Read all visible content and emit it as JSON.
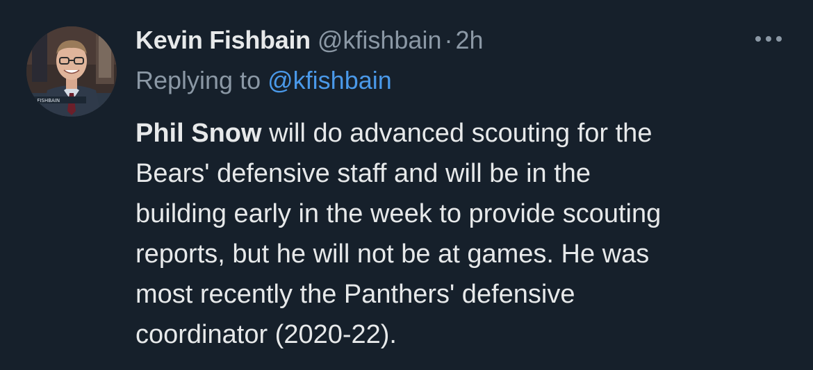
{
  "author": {
    "name": "Kevin Fishbain",
    "handle": "@kfishbain",
    "separator": "·",
    "time": "2h",
    "avatar_caption": "N FISHBAIN"
  },
  "reply": {
    "prefix": "Replying to",
    "mention": "@kfishbain"
  },
  "body": {
    "bold_name": "Phil Snow",
    "line1_rest": " will do advanced scouting for the",
    "lines": [
      "Bears' defensive staff and will be in the",
      "building early in the week to provide scouting",
      "reports, but he will not be at games. He was",
      "most recently the Panthers' defensive",
      "coordinator (2020-22)."
    ]
  },
  "icons": {
    "more": "more-options-icon"
  },
  "colors": {
    "background": "#16202b",
    "text_primary": "#e7e9ea",
    "text_secondary": "#8b98a5",
    "link": "#4a99e9"
  }
}
